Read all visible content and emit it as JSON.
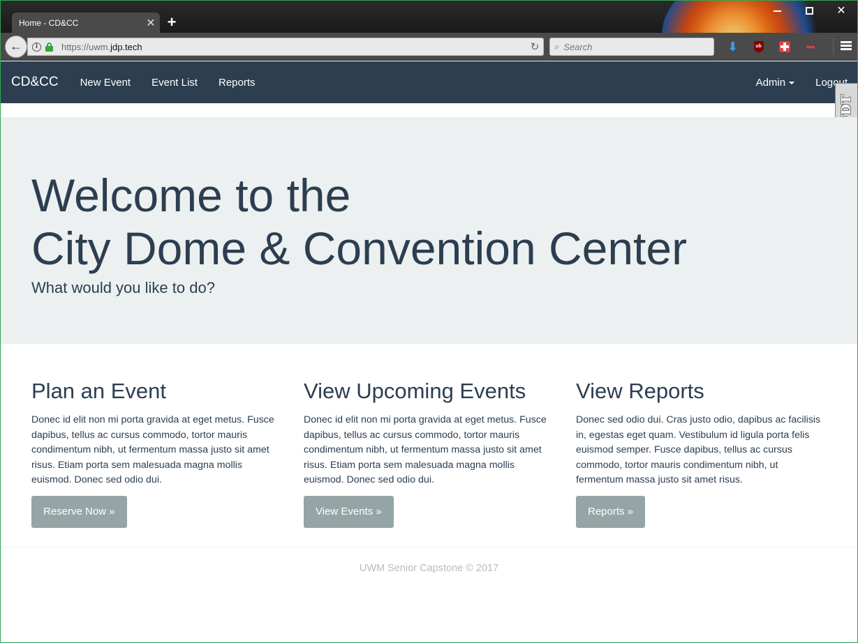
{
  "browser": {
    "tab_title": "Home - CD&CC",
    "tab_close": "✕",
    "new_tab": "+",
    "url_prefix": "https://uwm.",
    "url_host": "jdp.tech",
    "search_placeholder": "Search",
    "icons": [
      "back-arrow-icon",
      "info-icon",
      "lock-icon",
      "reload-icon",
      "search-icon",
      "download-icon",
      "ublock-icon",
      "extension-cross-icon",
      "extension-dots-icon",
      "hamburger-menu-icon"
    ]
  },
  "nav": {
    "brand": "CD&CC",
    "links": [
      "New Event",
      "Event List",
      "Reports"
    ],
    "admin": "Admin",
    "logout": "Logout"
  },
  "side_widget": {
    "label": "FDT"
  },
  "jumbotron": {
    "title_line1": "Welcome to the",
    "title_line2": "City Dome & Convention Center",
    "subtitle": "What would you like to do?"
  },
  "columns": [
    {
      "heading": "Plan an Event",
      "text": "Donec id elit non mi porta gravida at eget metus. Fusce dapibus, tellus ac cursus commodo, tortor mauris condimentum nibh, ut fermentum massa justo sit amet risus. Etiam porta sem malesuada magna mollis euismod. Donec sed odio dui.",
      "button": "Reserve Now »"
    },
    {
      "heading": "View Upcoming Events",
      "text": "Donec id elit non mi porta gravida at eget metus. Fusce dapibus, tellus ac cursus commodo, tortor mauris condimentum nibh, ut fermentum massa justo sit amet risus. Etiam porta sem malesuada magna mollis euismod. Donec sed odio dui.",
      "button": "View Events »"
    },
    {
      "heading": "View Reports",
      "text": "Donec sed odio dui. Cras justo odio, dapibus ac facilisis in, egestas eget quam. Vestibulum id ligula porta felis euismod semper. Fusce dapibus, tellus ac cursus commodo, tortor mauris condimentum nibh, ut fermentum massa justo sit amet risus.",
      "button": "Reports »"
    }
  ],
  "footer": {
    "text": "UWM Senior Capstone © 2017"
  },
  "colors": {
    "navbar": "#2c3e50",
    "jumbotron": "#ecf0f1",
    "button": "#95a5a6",
    "text": "#2c3e50",
    "footer_text": "#b4bcc2"
  }
}
